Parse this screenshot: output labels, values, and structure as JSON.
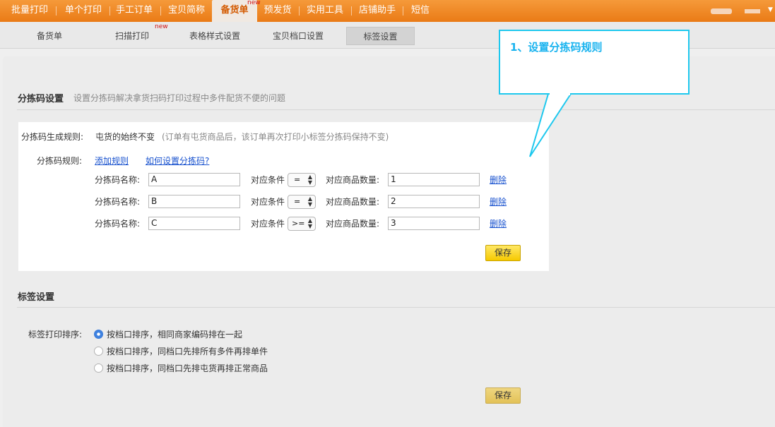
{
  "topnav": {
    "items": [
      "批量打印",
      "单个打印",
      "手工订单",
      "宝贝简称",
      "备货单",
      "预发货",
      "实用工具",
      "店铺助手",
      "短信"
    ],
    "active_index": 4,
    "new_badge": "new"
  },
  "subnav": {
    "tabs": [
      "备货单",
      "扫描打印",
      "表格样式设置",
      "宝贝档口设置",
      "标签设置"
    ],
    "active_index": 4,
    "new_badge": "new"
  },
  "callout": {
    "text": "1、设置分拣码规则"
  },
  "sort_code": {
    "title": "分拣码设置",
    "desc": "设置分拣码解决拿货扫码打印过程中多件配货不便的问题",
    "rule_label": "分拣码生成规则:",
    "rule_value": "屯货的始终不变",
    "rule_note": "(订单有屯货商品后，该订单再次打印小标签分拣码保持不变)",
    "rules_label": "分拣码规则:",
    "add_rule": "添加规则",
    "how_to": "如何设置分拣码?",
    "name_label": "分拣码名称:",
    "cond_label": "对应条件",
    "qty_label": "对应商品数量:",
    "delete": "删除",
    "rows": [
      {
        "name": "A",
        "cond": "=",
        "qty": "1"
      },
      {
        "name": "B",
        "cond": "=",
        "qty": "2"
      },
      {
        "name": "C",
        "cond": ">=",
        "qty": "3"
      }
    ],
    "save": "保存"
  },
  "label_settings": {
    "title": "标签设置",
    "sort_label": "标签打印排序:",
    "options": [
      "按档口排序，相同商家编码排在一起",
      "按档口排序，同档口先排所有多件再排单件",
      "按档口排序，同档口先排屯货再排正常商品"
    ],
    "selected_index": 0,
    "save": "保存"
  }
}
